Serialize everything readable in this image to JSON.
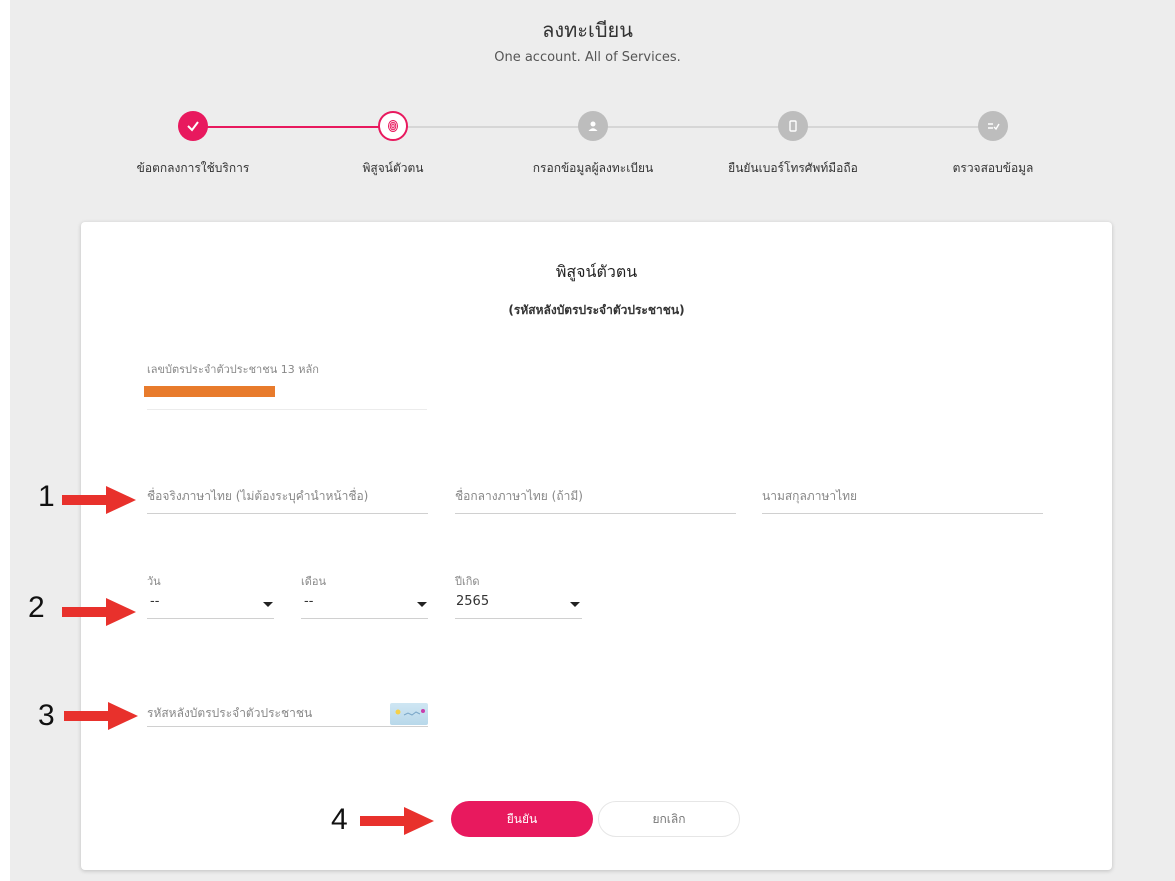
{
  "header": {
    "title": "ลงทะเบียน",
    "subtitle": "One account. All of Services."
  },
  "stepper": {
    "steps": [
      {
        "label": "ข้อตกลงการใช้บริการ",
        "state": "completed",
        "icon": "check-icon"
      },
      {
        "label": "พิสูจน์ตัวตน",
        "state": "active",
        "icon": "fingerprint-icon"
      },
      {
        "label": "กรอกข้อมูลผู้ลงทะเบียน",
        "state": "pending",
        "icon": "user-icon"
      },
      {
        "label": "ยืนยันเบอร์โทรศัพท์มือถือ",
        "state": "pending",
        "icon": "mobile-icon"
      },
      {
        "label": "ตรวจสอบข้อมูล",
        "state": "pending",
        "icon": "checklist-icon"
      }
    ],
    "colors": {
      "active": "#e8195e",
      "pending": "#bdbdbd"
    }
  },
  "form": {
    "title": "พิสูจน์ตัวตน",
    "subtitle": "(รหัสหลังบัตรประจำตัวประชาชน)",
    "id_card": {
      "label": "เลขบัตรประจำตัวประชาชน 13 หลัก"
    },
    "first_name": {
      "placeholder": "ชื่อจริงภาษาไทย (ไม่ต้องระบุคำนำหน้าชื่อ)"
    },
    "middle_name": {
      "placeholder": "ชื่อกลางภาษาไทย (ถ้ามี)"
    },
    "last_name": {
      "placeholder": "นามสกุลภาษาไทย"
    },
    "day": {
      "label": "วัน",
      "value": "--"
    },
    "month": {
      "label": "เดือน",
      "value": "--"
    },
    "year": {
      "label": "ปีเกิด",
      "value": "2565"
    },
    "laser_code": {
      "placeholder": "รหัสหลังบัตรประจำตัวประชาชน",
      "icon": "id-card-back-icon"
    },
    "confirm_label": "ยืนยัน",
    "cancel_label": "ยกเลิก"
  },
  "annotations": [
    "1",
    "2",
    "3",
    "4"
  ],
  "colors": {
    "accent": "#e8195e",
    "arrow": "#e8312c",
    "redaction": "#e87b2c"
  }
}
